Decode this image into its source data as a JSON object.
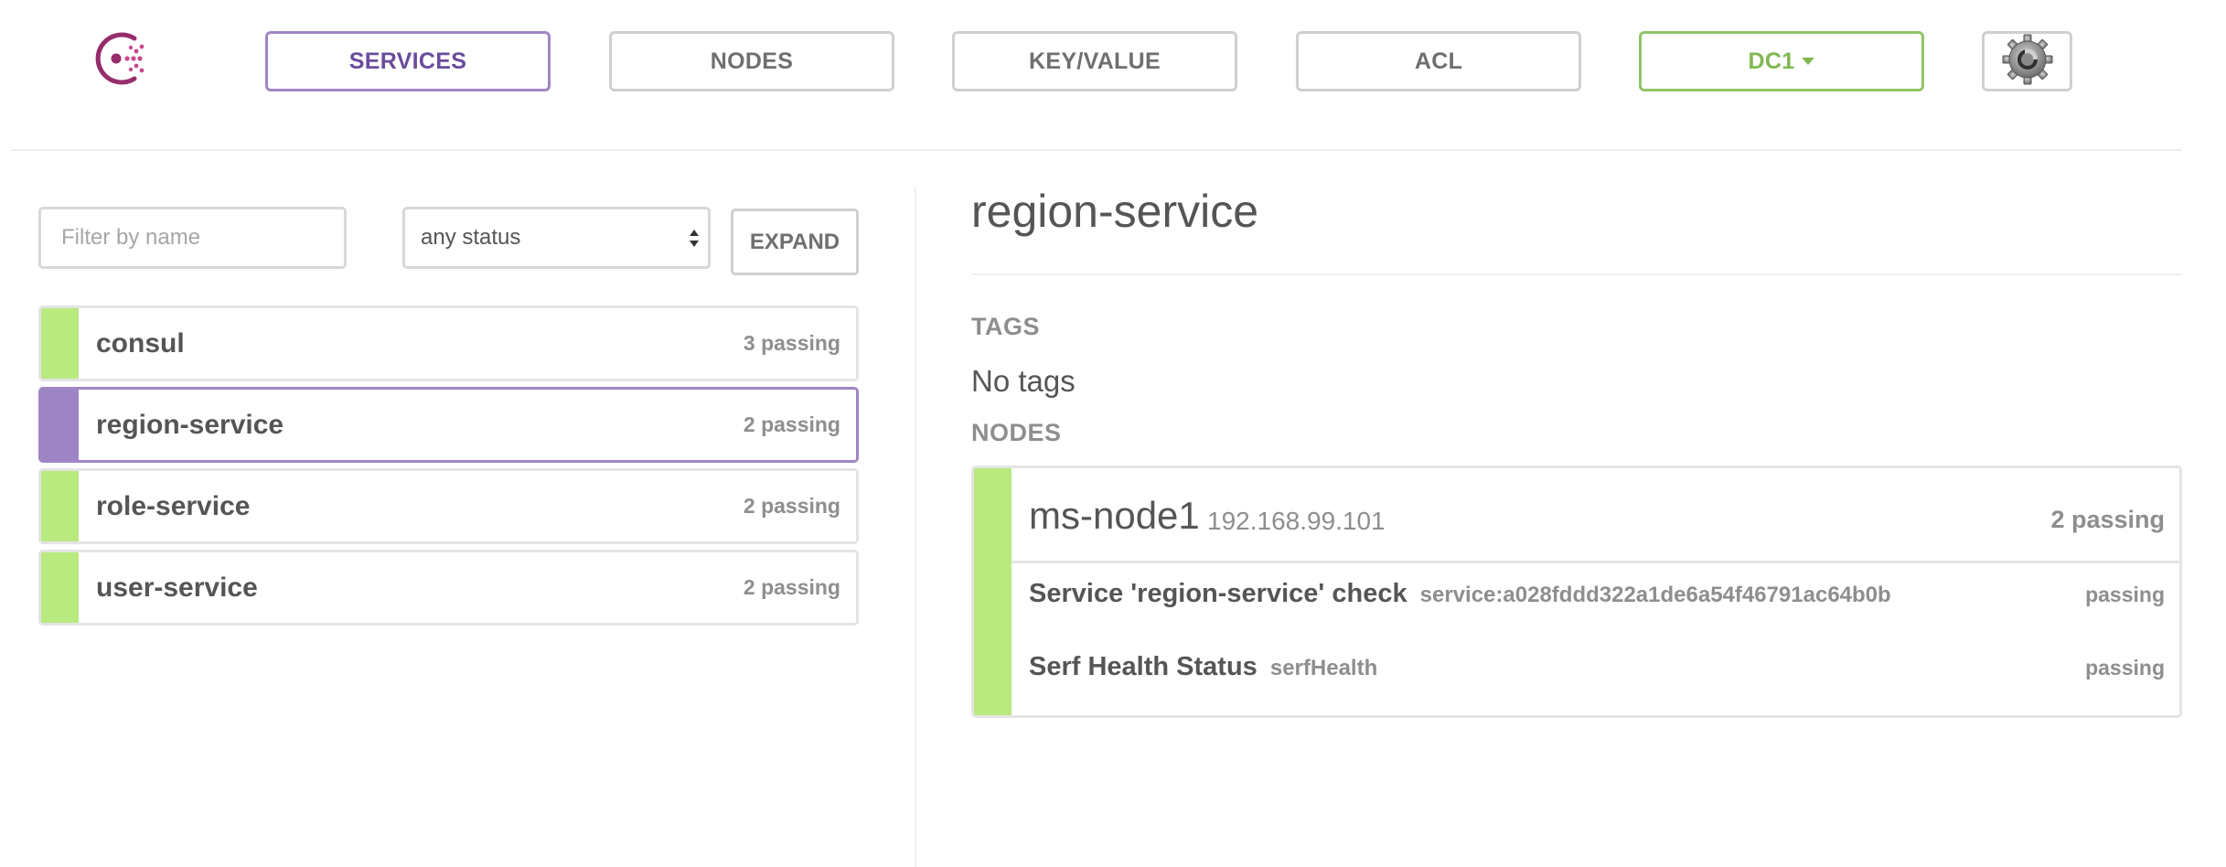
{
  "nav": {
    "services": "SERVICES",
    "nodes": "NODES",
    "key_value": "KEY/VALUE",
    "acl": "ACL",
    "datacenter": "DC1"
  },
  "icons": {
    "logo": "consul-logo",
    "settings": "gear-icon",
    "dropdown": "caret-down-icon"
  },
  "colors": {
    "accent_purple": "#9d84c5",
    "passing_green": "#b9ea7f",
    "dc_green": "#81b851"
  },
  "filter": {
    "name_placeholder": "Filter by name",
    "status_value": "any status",
    "expand_label": "EXPAND"
  },
  "services": [
    {
      "name": "consul",
      "status": "3 passing"
    },
    {
      "name": "region-service",
      "status": "2 passing",
      "selected": true
    },
    {
      "name": "role-service",
      "status": "2 passing"
    },
    {
      "name": "user-service",
      "status": "2 passing"
    }
  ],
  "detail": {
    "title": "region-service",
    "tags_label": "TAGS",
    "tags_value": "No tags",
    "nodes_label": "NODES",
    "node": {
      "name": "ms-node1",
      "ip": "192.168.99.101",
      "status": "2 passing",
      "checks": [
        {
          "name": "Service 'region-service' check",
          "id": "service:a028fddd322a1de6a54f46791ac64b0b",
          "status": "passing"
        },
        {
          "name": "Serf Health Status",
          "id": "serfHealth",
          "status": "passing"
        }
      ]
    }
  }
}
